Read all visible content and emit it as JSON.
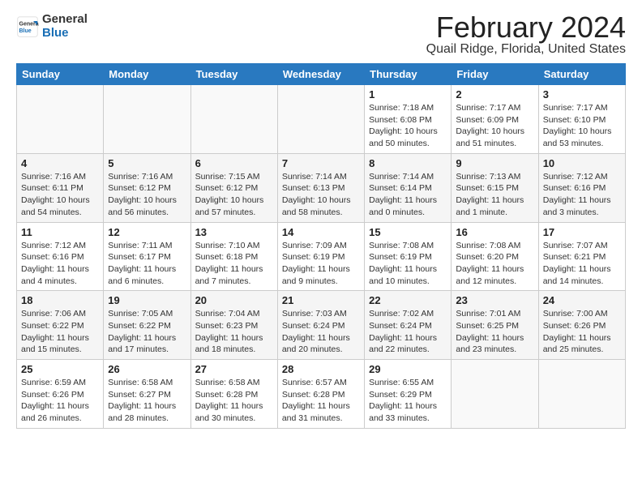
{
  "header": {
    "logo_general": "General",
    "logo_blue": "Blue",
    "title": "February 2024",
    "location": "Quail Ridge, Florida, United States"
  },
  "days_of_week": [
    "Sunday",
    "Monday",
    "Tuesday",
    "Wednesday",
    "Thursday",
    "Friday",
    "Saturday"
  ],
  "weeks": [
    [
      {
        "day": "",
        "info": ""
      },
      {
        "day": "",
        "info": ""
      },
      {
        "day": "",
        "info": ""
      },
      {
        "day": "",
        "info": ""
      },
      {
        "day": "1",
        "info": "Sunrise: 7:18 AM\nSunset: 6:08 PM\nDaylight: 10 hours\nand 50 minutes."
      },
      {
        "day": "2",
        "info": "Sunrise: 7:17 AM\nSunset: 6:09 PM\nDaylight: 10 hours\nand 51 minutes."
      },
      {
        "day": "3",
        "info": "Sunrise: 7:17 AM\nSunset: 6:10 PM\nDaylight: 10 hours\nand 53 minutes."
      }
    ],
    [
      {
        "day": "4",
        "info": "Sunrise: 7:16 AM\nSunset: 6:11 PM\nDaylight: 10 hours\nand 54 minutes."
      },
      {
        "day": "5",
        "info": "Sunrise: 7:16 AM\nSunset: 6:12 PM\nDaylight: 10 hours\nand 56 minutes."
      },
      {
        "day": "6",
        "info": "Sunrise: 7:15 AM\nSunset: 6:12 PM\nDaylight: 10 hours\nand 57 minutes."
      },
      {
        "day": "7",
        "info": "Sunrise: 7:14 AM\nSunset: 6:13 PM\nDaylight: 10 hours\nand 58 minutes."
      },
      {
        "day": "8",
        "info": "Sunrise: 7:14 AM\nSunset: 6:14 PM\nDaylight: 11 hours\nand 0 minutes."
      },
      {
        "day": "9",
        "info": "Sunrise: 7:13 AM\nSunset: 6:15 PM\nDaylight: 11 hours\nand 1 minute."
      },
      {
        "day": "10",
        "info": "Sunrise: 7:12 AM\nSunset: 6:16 PM\nDaylight: 11 hours\nand 3 minutes."
      }
    ],
    [
      {
        "day": "11",
        "info": "Sunrise: 7:12 AM\nSunset: 6:16 PM\nDaylight: 11 hours\nand 4 minutes."
      },
      {
        "day": "12",
        "info": "Sunrise: 7:11 AM\nSunset: 6:17 PM\nDaylight: 11 hours\nand 6 minutes."
      },
      {
        "day": "13",
        "info": "Sunrise: 7:10 AM\nSunset: 6:18 PM\nDaylight: 11 hours\nand 7 minutes."
      },
      {
        "day": "14",
        "info": "Sunrise: 7:09 AM\nSunset: 6:19 PM\nDaylight: 11 hours\nand 9 minutes."
      },
      {
        "day": "15",
        "info": "Sunrise: 7:08 AM\nSunset: 6:19 PM\nDaylight: 11 hours\nand 10 minutes."
      },
      {
        "day": "16",
        "info": "Sunrise: 7:08 AM\nSunset: 6:20 PM\nDaylight: 11 hours\nand 12 minutes."
      },
      {
        "day": "17",
        "info": "Sunrise: 7:07 AM\nSunset: 6:21 PM\nDaylight: 11 hours\nand 14 minutes."
      }
    ],
    [
      {
        "day": "18",
        "info": "Sunrise: 7:06 AM\nSunset: 6:22 PM\nDaylight: 11 hours\nand 15 minutes."
      },
      {
        "day": "19",
        "info": "Sunrise: 7:05 AM\nSunset: 6:22 PM\nDaylight: 11 hours\nand 17 minutes."
      },
      {
        "day": "20",
        "info": "Sunrise: 7:04 AM\nSunset: 6:23 PM\nDaylight: 11 hours\nand 18 minutes."
      },
      {
        "day": "21",
        "info": "Sunrise: 7:03 AM\nSunset: 6:24 PM\nDaylight: 11 hours\nand 20 minutes."
      },
      {
        "day": "22",
        "info": "Sunrise: 7:02 AM\nSunset: 6:24 PM\nDaylight: 11 hours\nand 22 minutes."
      },
      {
        "day": "23",
        "info": "Sunrise: 7:01 AM\nSunset: 6:25 PM\nDaylight: 11 hours\nand 23 minutes."
      },
      {
        "day": "24",
        "info": "Sunrise: 7:00 AM\nSunset: 6:26 PM\nDaylight: 11 hours\nand 25 minutes."
      }
    ],
    [
      {
        "day": "25",
        "info": "Sunrise: 6:59 AM\nSunset: 6:26 PM\nDaylight: 11 hours\nand 26 minutes."
      },
      {
        "day": "26",
        "info": "Sunrise: 6:58 AM\nSunset: 6:27 PM\nDaylight: 11 hours\nand 28 minutes."
      },
      {
        "day": "27",
        "info": "Sunrise: 6:58 AM\nSunset: 6:28 PM\nDaylight: 11 hours\nand 30 minutes."
      },
      {
        "day": "28",
        "info": "Sunrise: 6:57 AM\nSunset: 6:28 PM\nDaylight: 11 hours\nand 31 minutes."
      },
      {
        "day": "29",
        "info": "Sunrise: 6:55 AM\nSunset: 6:29 PM\nDaylight: 11 hours\nand 33 minutes."
      },
      {
        "day": "",
        "info": ""
      },
      {
        "day": "",
        "info": ""
      }
    ]
  ]
}
